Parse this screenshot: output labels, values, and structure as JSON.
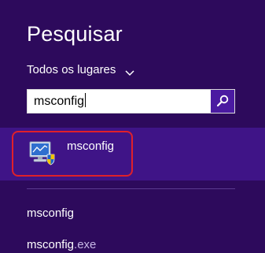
{
  "panel": {
    "title": "Pesquisar",
    "scope_label": "Todos os lugares"
  },
  "search": {
    "value": "msconfig"
  },
  "top_result": {
    "label": "msconfig",
    "icon": "system-config-icon"
  },
  "suggestions": [
    {
      "match": "msconfig",
      "rest": ""
    },
    {
      "match": "msconfig",
      "rest": ".exe"
    }
  ],
  "colors": {
    "background": "#2d0a5c",
    "highlight": "#3f1487",
    "search_button": "#4a1aa1",
    "annotation_outline": "#e0202a"
  }
}
